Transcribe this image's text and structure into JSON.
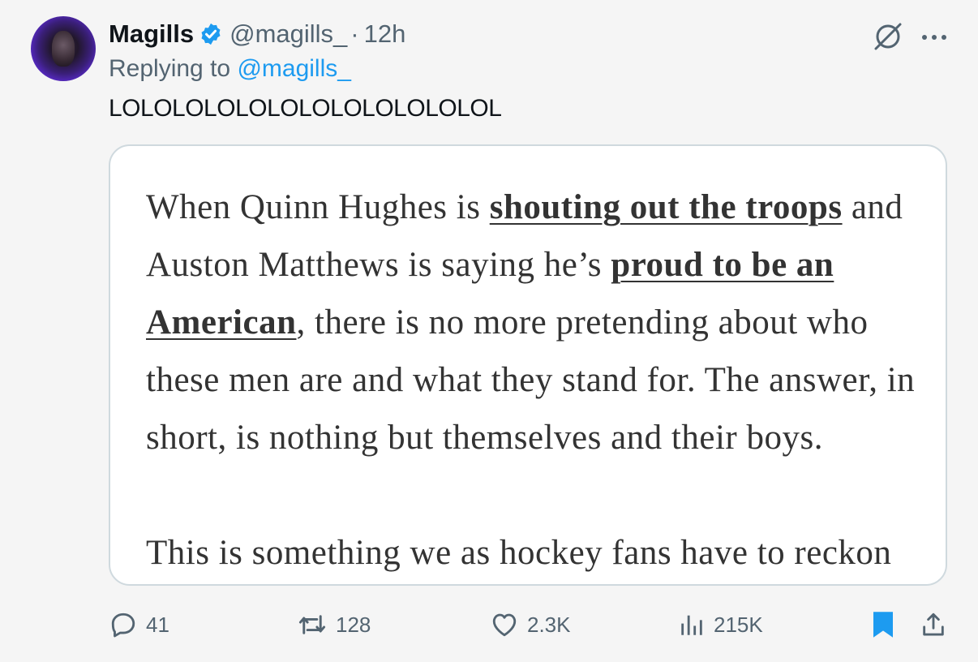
{
  "author": {
    "name": "Magills",
    "handle": "@magills_",
    "separator": "·",
    "time": "12h",
    "avatar_icon": "avatar-photo",
    "verified_icon": "verified-badge-icon",
    "verified_color": "#1d9bf0"
  },
  "reply": {
    "prefix": "Replying to",
    "mention": "@magills_"
  },
  "tweet": {
    "text": "LOLOLOLOLOLOLOLOLOLOLOLOL"
  },
  "card": {
    "p1_a": "When Quinn Hughes is ",
    "p1_link1": "shouting out the troops",
    "p1_b": " and Auston Matthews is saying he’s ",
    "p1_link2": "proud to be an American",
    "p1_c": ", there is no more pretending about who these men are and what they stand for. The answer, in short, is nothing but themselves and their boys.",
    "p2": "This is something we as hockey fans have to reckon with"
  },
  "actions": {
    "replies": "41",
    "reposts": "128",
    "likes": "2.3K",
    "views": "215K"
  },
  "colors": {
    "accent": "#1d9bf0",
    "muted": "#536471",
    "border": "#cfd9de"
  }
}
